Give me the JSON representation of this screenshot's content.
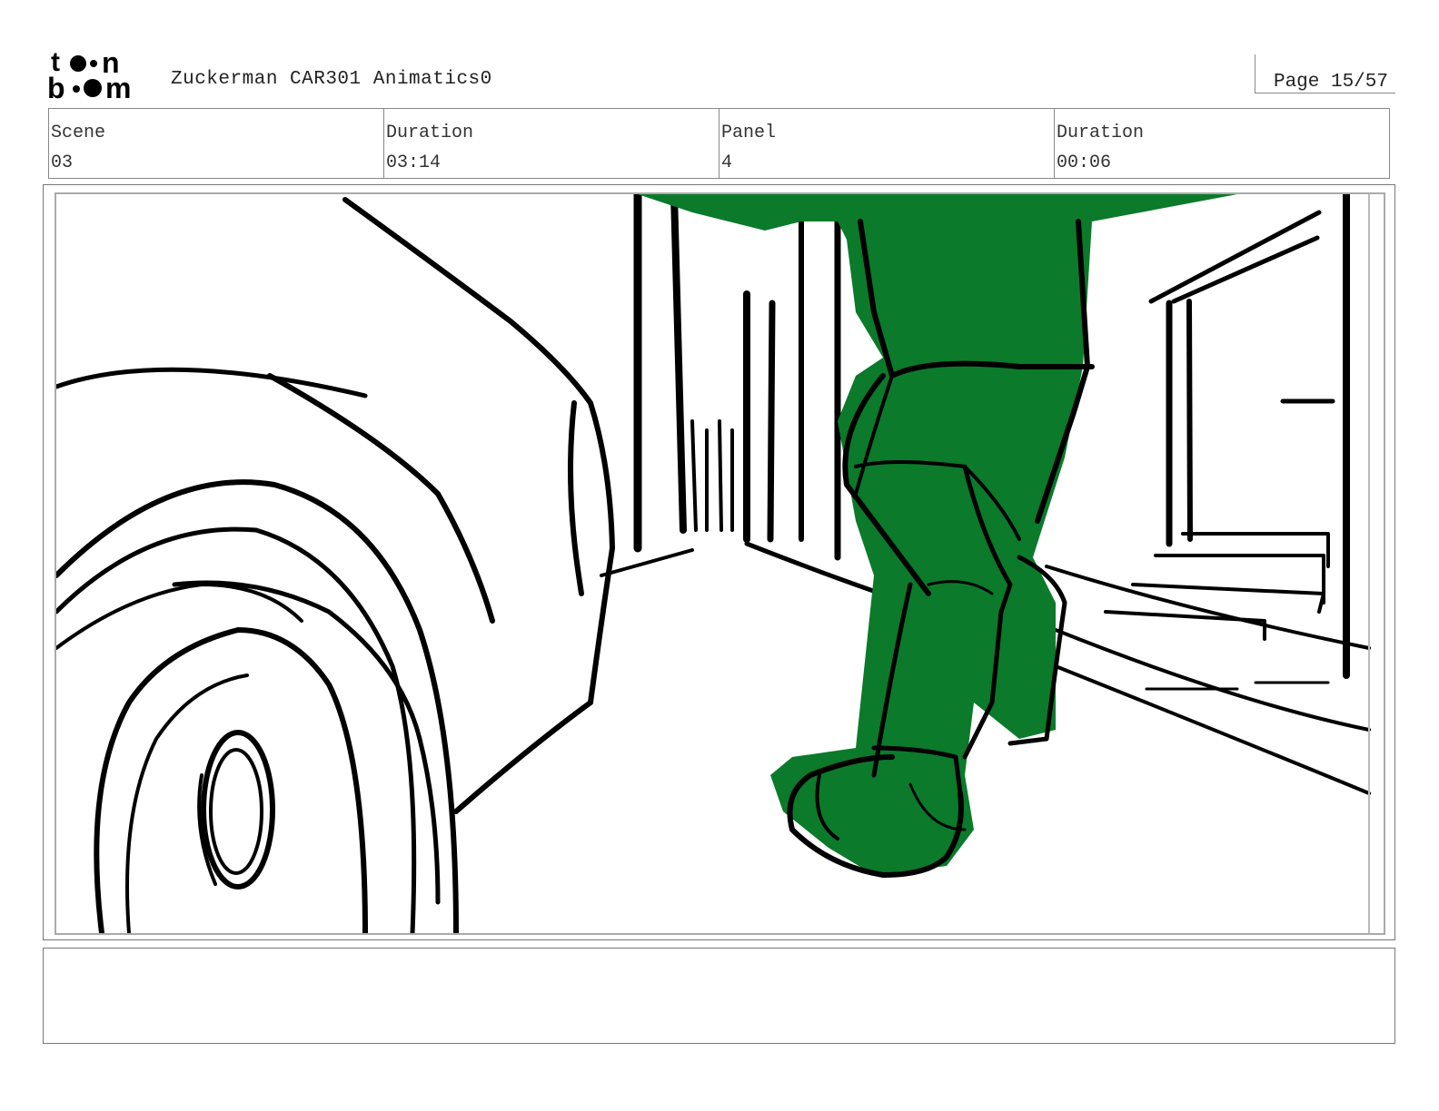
{
  "header": {
    "logo_icon": "toonboom-logo",
    "title": "Zuckerman CAR301 Animatics0",
    "page_label": "Page 15/57"
  },
  "info": {
    "scene_label": "Scene",
    "scene_value": "03",
    "scene_duration_label": "Duration",
    "scene_duration_value": "03:14",
    "panel_label": "Panel",
    "panel_value": "4",
    "panel_duration_label": "Duration",
    "panel_duration_value": "00:06"
  },
  "panel": {
    "sketch_icon": "storyboard-sketch-car-wheel-and-green-character-legs",
    "character_color": "#0b7a2a",
    "line_color": "#000000"
  },
  "notes": {
    "text": ""
  }
}
